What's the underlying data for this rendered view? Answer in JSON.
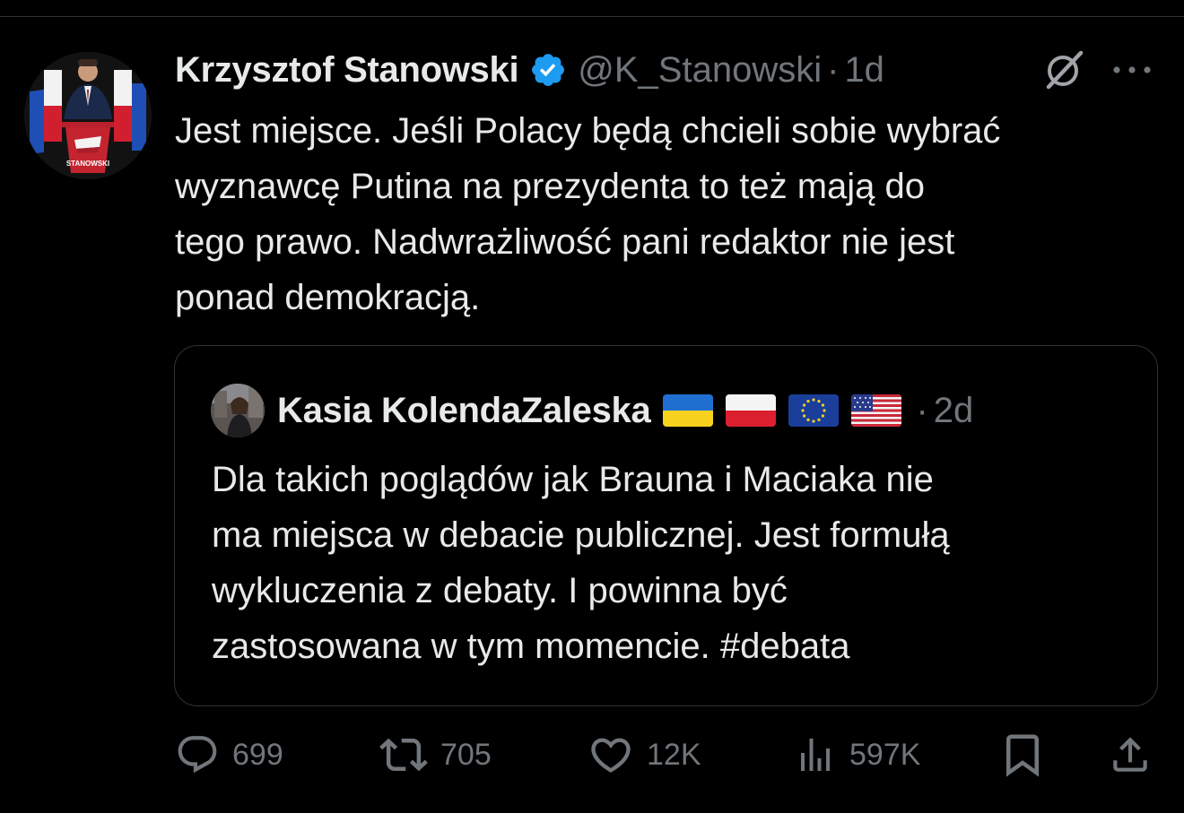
{
  "tweet": {
    "author_name": "Krzysztof Stanowski",
    "handle": "@K_Stanowski",
    "separator": "·",
    "time": "1d",
    "avatar_text": "STANOWSKI",
    "text_lines": [
      "Jest miejsce. Jeśli Polacy będą chcieli sobie wybrać",
      "wyznawcę Putina na prezydenta to też mają do",
      "tego prawo. Nadwrażliwość pani redaktor nie jest",
      "ponad demokracją."
    ]
  },
  "quote": {
    "author_name": "Kasia KolendaZaleska",
    "flags": [
      "ukraine-flag",
      "poland-flag",
      "eu-flag",
      "usa-flag"
    ],
    "separator": "·",
    "time": "2d",
    "text_lines": [
      "Dla takich poglądów jak Brauna i Maciaka nie",
      "ma miejsca w debacie publicznej. Jest formułą",
      "wykluczenia z debaty. I powinna być",
      "zastosowana w tym momencie. #debata"
    ]
  },
  "actions": {
    "replies": "699",
    "retweets": "705",
    "likes": "12K",
    "views": "597K"
  },
  "colors": {
    "background": "#000000",
    "text": "#e7e9ea",
    "muted": "#71767b",
    "border": "#2f3336",
    "verified": "#1d9bf0"
  }
}
